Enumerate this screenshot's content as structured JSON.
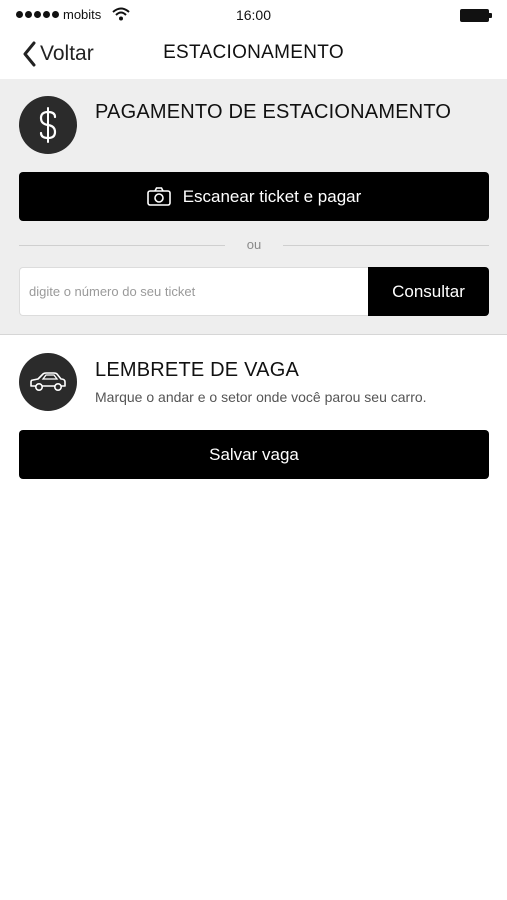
{
  "status_bar": {
    "carrier": "mobits",
    "time": "16:00"
  },
  "nav": {
    "back_label": "Voltar",
    "title": "ESTACIONAMENTO"
  },
  "payment": {
    "title": "PAGAMENTO DE ESTACIONAMENTO",
    "scan_button_label": "Escanear ticket e pagar",
    "divider_text": "ou",
    "ticket_placeholder": "digite o número do seu ticket",
    "ticket_value": "",
    "consult_button_label": "Consultar"
  },
  "reminder": {
    "title": "LEMBRETE DE VAGA",
    "description": "Marque o andar e o setor onde você parou seu carro.",
    "save_button_label": "Salvar vaga"
  },
  "colors": {
    "primary": "#000000",
    "section_background": "#eeeeee",
    "icon_circle": "#2b2b2b"
  },
  "icons": [
    "signal-icon",
    "wifi-icon",
    "battery-icon",
    "chevron-left-icon",
    "dollar-icon",
    "camera-icon",
    "car-icon"
  ]
}
